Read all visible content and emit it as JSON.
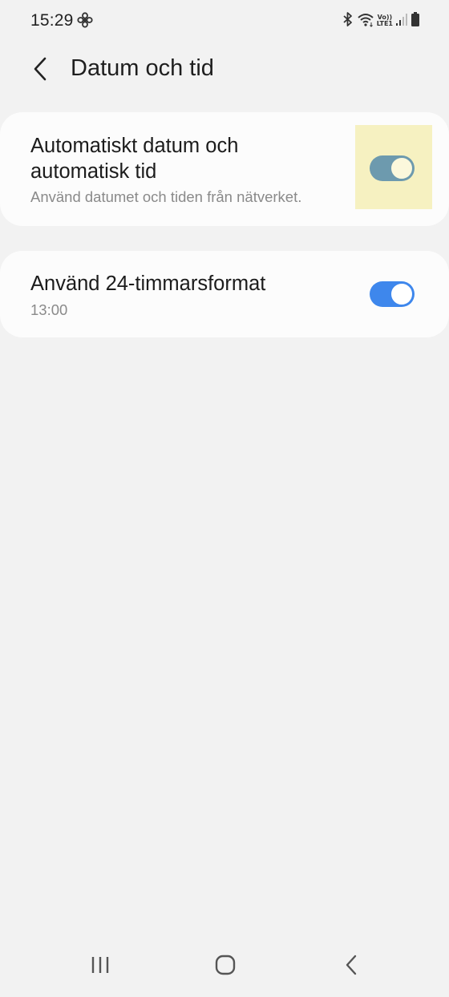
{
  "status_bar": {
    "time": "15:29",
    "volte_line1": "Vo))",
    "volte_line2": "LTE1",
    "icons": [
      "fan-icon",
      "bluetooth-icon",
      "wifi-icon",
      "volte-lte-icon",
      "signal-icon",
      "battery-icon"
    ]
  },
  "header": {
    "back_icon": "chevron-left-icon",
    "title": "Datum och tid"
  },
  "settings": [
    {
      "title": "Automatiskt datum och automatisk tid",
      "subtitle": "Använd datumet och tiden från nätverket.",
      "toggle_on": true,
      "highlighted": true
    },
    {
      "title": "Använd 24-timmarsformat",
      "subtitle": "13:00",
      "toggle_on": true,
      "highlighted": false
    }
  ],
  "navigation_bar": {
    "buttons": [
      "recent-apps-icon",
      "home-icon",
      "back-icon"
    ]
  },
  "colors": {
    "background": "#f2f2f2",
    "card": "#fcfcfc",
    "toggle_accent": "#3e87ec",
    "toggle_highlighted": "#6d9aae",
    "highlight_box": "#f6f1c1",
    "subtitle_text": "#8a8a8a"
  }
}
